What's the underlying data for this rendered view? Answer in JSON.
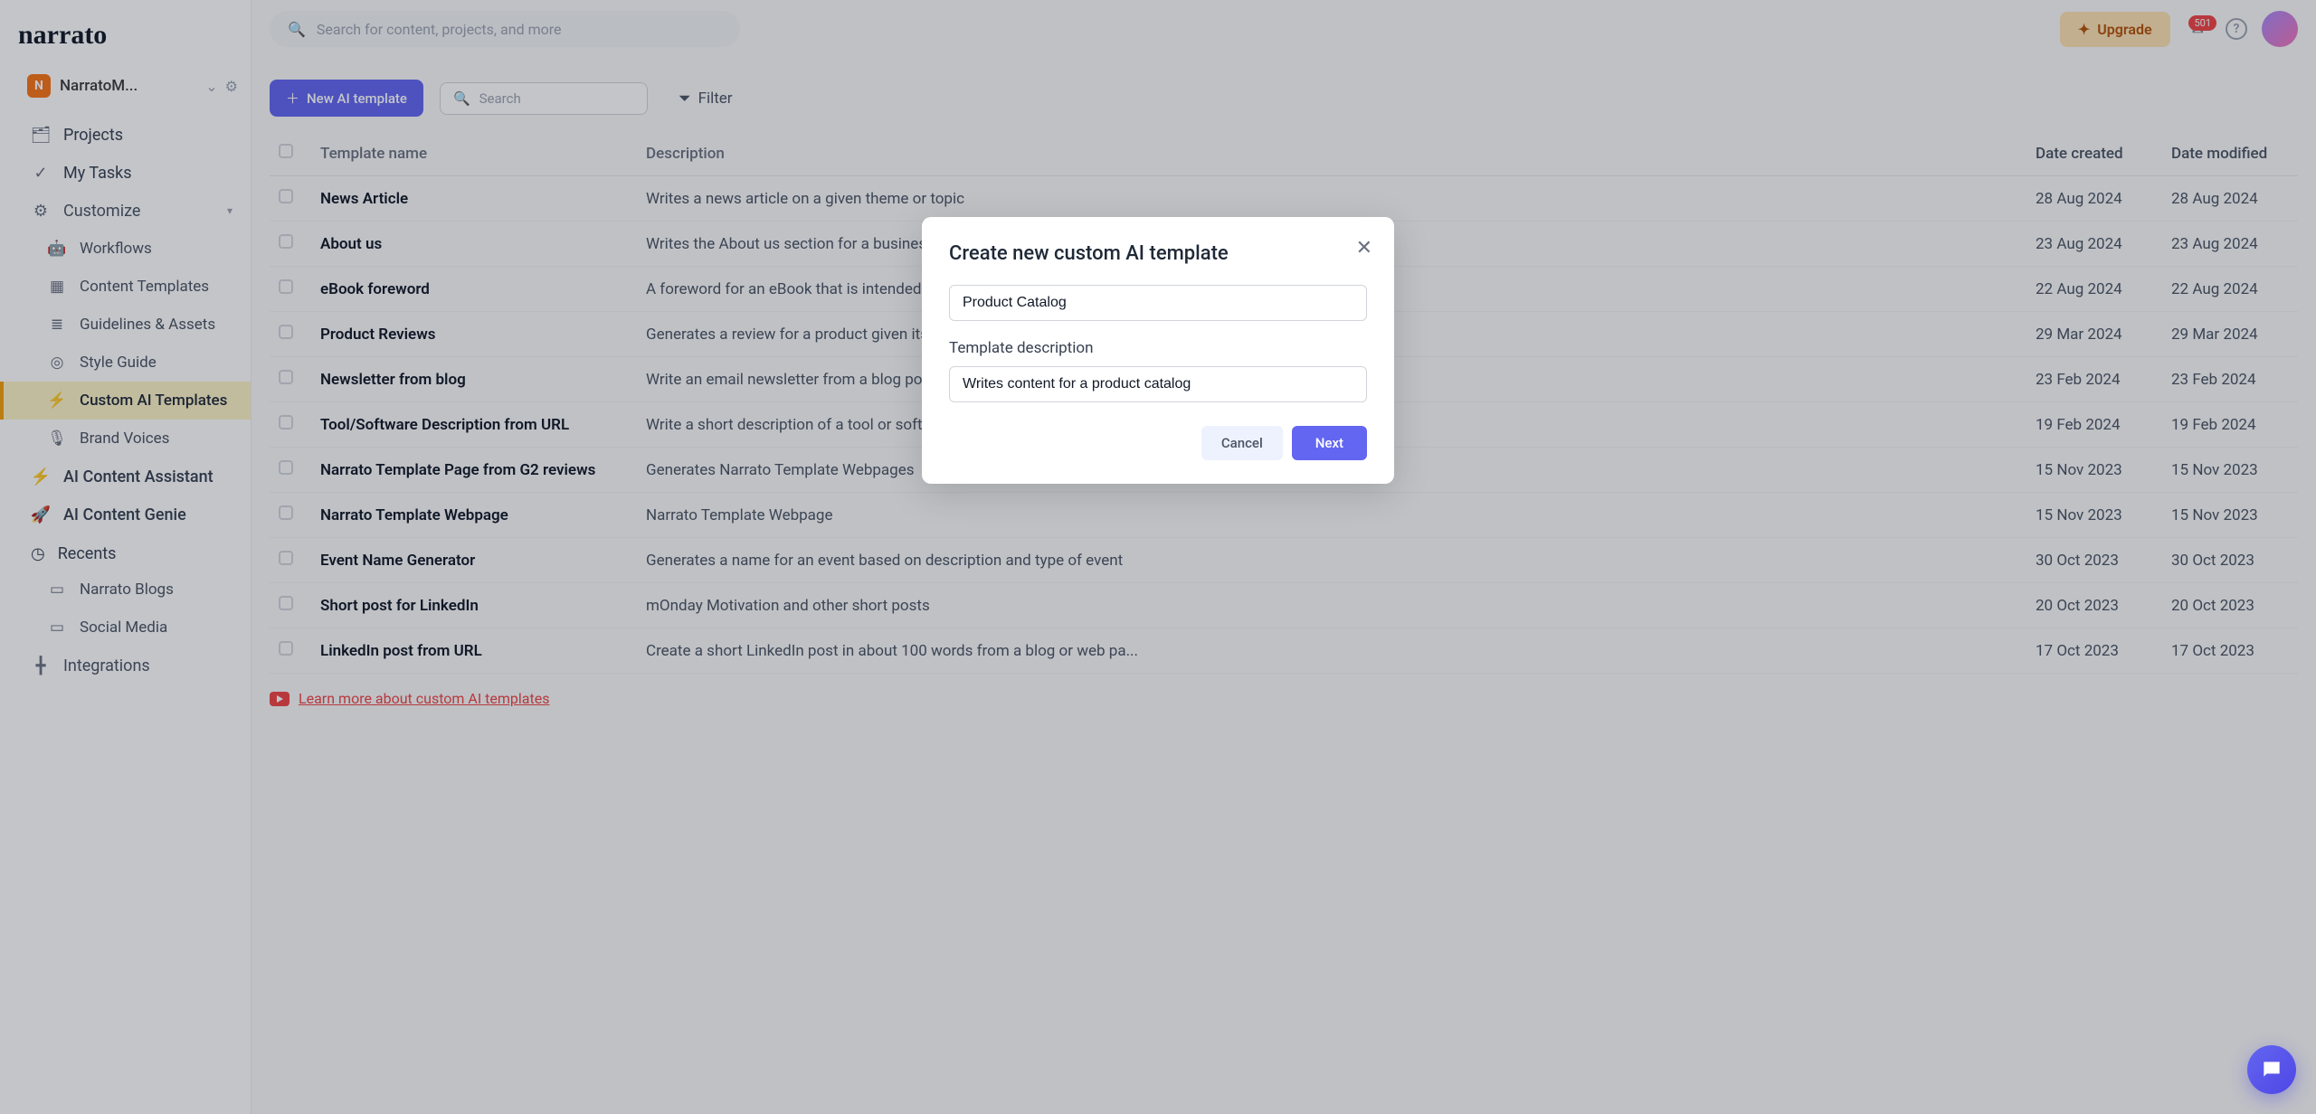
{
  "workspace": {
    "badge": "N",
    "name": "NarratoM..."
  },
  "topbar": {
    "search_placeholder": "Search for content, projects, and more",
    "upgrade": "Upgrade",
    "notification_count": "501"
  },
  "sidebar": {
    "projects": "Projects",
    "my_tasks": "My Tasks",
    "customize": "Customize",
    "workflows": "Workflows",
    "content_templates": "Content Templates",
    "guidelines_assets": "Guidelines & Assets",
    "style_guide": "Style Guide",
    "custom_ai_templates": "Custom AI Templates",
    "brand_voices": "Brand Voices",
    "ai_content_assistant": "AI Content Assistant",
    "ai_content_genie": "AI Content Genie",
    "recents": "Recents",
    "recent_items": [
      "Narrato Blogs",
      "Social Media"
    ],
    "integrations": "Integrations"
  },
  "toolbar": {
    "new_template": "New AI template",
    "search_placeholder": "Search",
    "filter": "Filter"
  },
  "table": {
    "headers": {
      "name": "Template name",
      "description": "Description",
      "created": "Date created",
      "modified": "Date modified"
    },
    "rows": [
      {
        "name": "News Article",
        "description": "Writes a news article on a given theme or topic",
        "created": "28 Aug 2024",
        "modified": "28 Aug 2024"
      },
      {
        "name": "About us",
        "description": "Writes the About us section for a business portfolio website",
        "created": "23 Aug 2024",
        "modified": "23 Aug 2024"
      },
      {
        "name": "eBook foreword",
        "description": "A foreword for an eBook that is intended to give some insight as t...",
        "created": "22 Aug 2024",
        "modified": "22 Aug 2024"
      },
      {
        "name": "Product Reviews",
        "description": "Generates a review for a product given its specifications",
        "created": "29 Mar 2024",
        "modified": "29 Mar 2024"
      },
      {
        "name": "Newsletter from blog",
        "description": "Write an email newsletter from a blog post URL",
        "created": "23 Feb 2024",
        "modified": "23 Feb 2024"
      },
      {
        "name": "Tool/Software Description from URL",
        "description": "Write a short description of a tool or software from URL",
        "created": "19 Feb 2024",
        "modified": "19 Feb 2024"
      },
      {
        "name": "Narrato Template Page from G2 reviews",
        "description": "Generates Narrato Template Webpages",
        "created": "15 Nov 2023",
        "modified": "15 Nov 2023"
      },
      {
        "name": "Narrato Template Webpage",
        "description": "Narrato Template Webpage",
        "created": "15 Nov 2023",
        "modified": "15 Nov 2023"
      },
      {
        "name": "Event Name Generator",
        "description": "Generates a name for an event based on description and type of event",
        "created": "30 Oct 2023",
        "modified": "30 Oct 2023"
      },
      {
        "name": "Short post for LinkedIn",
        "description": "mOnday Motivation and other short posts",
        "created": "20 Oct 2023",
        "modified": "20 Oct 2023"
      },
      {
        "name": "LinkedIn post from URL",
        "description": "Create a short LinkedIn post in about 100 words from a blog or web pa...",
        "created": "17 Oct 2023",
        "modified": "17 Oct 2023"
      }
    ]
  },
  "learn_more": "Learn more about custom AI templates",
  "modal": {
    "title": "Create new custom AI template",
    "name_value": "Product Catalog",
    "desc_label": "Template description",
    "desc_value": "Writes content for a product catalog",
    "cancel": "Cancel",
    "next": "Next"
  }
}
